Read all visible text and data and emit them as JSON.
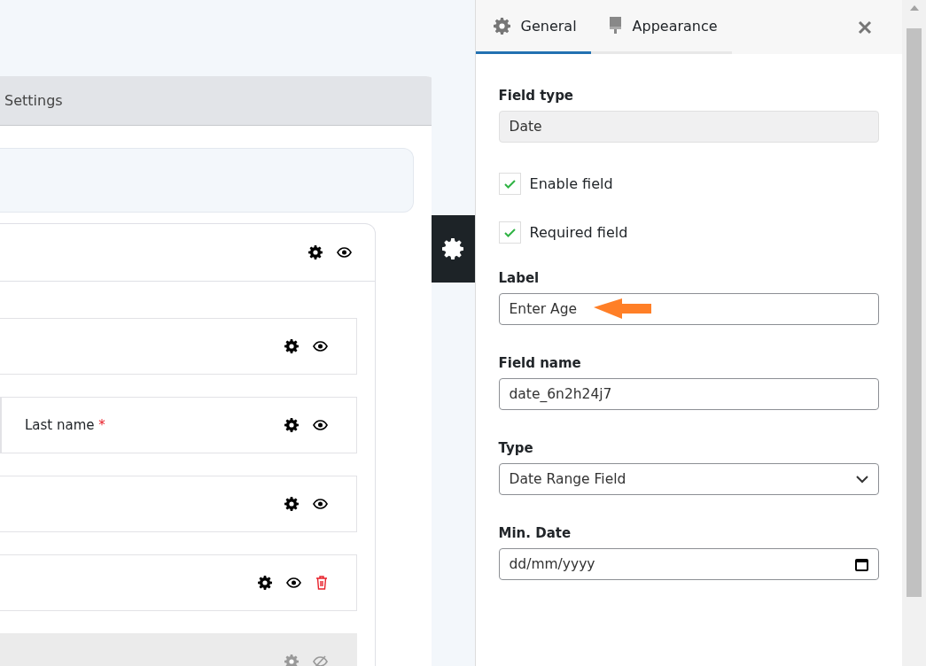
{
  "builder": {
    "tab": "Settings",
    "rows": [
      {
        "kind": "single",
        "deletable": false,
        "disabled": false
      },
      {
        "kind": "two-column",
        "label": "Last name",
        "required_mark": "*",
        "deletable": false,
        "disabled": false
      },
      {
        "kind": "single",
        "deletable": false,
        "disabled": false
      },
      {
        "kind": "single",
        "deletable": true,
        "disabled": false
      },
      {
        "kind": "single",
        "deletable": false,
        "disabled": true
      }
    ]
  },
  "panel": {
    "tabs": [
      {
        "label": "General",
        "selected": true
      },
      {
        "label": "Appearance",
        "selected": false
      }
    ],
    "fields": [
      {
        "kind": "readonly",
        "label": "Field type",
        "value": "Date"
      },
      {
        "kind": "checkbox",
        "label": "Enable field",
        "checked": true
      },
      {
        "kind": "checkbox",
        "label": "Required field",
        "checked": true
      },
      {
        "kind": "text",
        "label": "Label",
        "value": "Enter Age",
        "highlighted": true
      },
      {
        "kind": "text",
        "label": "Field name",
        "value": "date_6n2h24j7"
      },
      {
        "kind": "select",
        "label": "Type",
        "value": "Date Range Field"
      },
      {
        "kind": "date",
        "label": "Min. Date",
        "placeholder": "dd/mm/yyyy"
      }
    ]
  }
}
